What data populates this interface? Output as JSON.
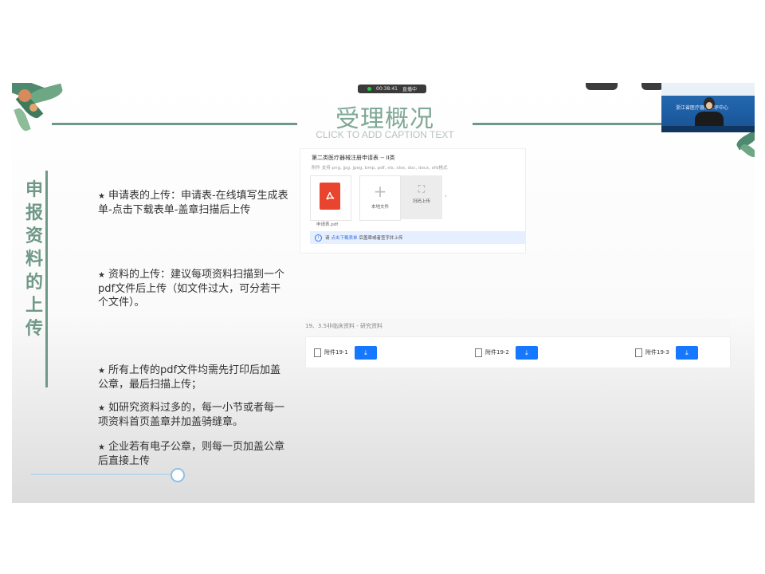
{
  "recording": {
    "time": "00:38:41",
    "status": "直播中"
  },
  "slide": {
    "title": "受理概况",
    "subtitle": "CLICK TO ADD CAPTION TEXT",
    "side_heading": "申报资料的上传",
    "bullets": [
      "申请表的上传：申请表-在线填写生成表单-点击下载表单-盖章扫描后上传",
      "资料的上传：建议每项资料扫描到一个pdf文件后上传（如文件过大，可分若干个文件）。",
      "所有上传的pdf文件均需先打印后加盖公章，最后扫描上传；",
      "如研究资料过多的，每一小节或者每一项资料首页盖章并加盖骑缝章。",
      "企业若有电子公章，则每一页加盖公章后直接上传"
    ],
    "bullet_star": "★"
  },
  "upload_form": {
    "title": "第二类医疗器械注册申请表 -- II类",
    "hint": "附件  支持 png, jpg, jpeg, bmp, pdf, xls, xlsx, doc, docx, ofd格式",
    "pdf_file_name": "申请表.pdf",
    "local_file_label": "本地文件",
    "scan_upload_label": "扫码上传",
    "notice_prefix": "请",
    "notice_link": "点击下载表单",
    "notice_suffix": "后盖章或者签字并上传"
  },
  "research": {
    "header": "19、3.5非临床资料 - 研究资料",
    "attachments": [
      {
        "name": "附件19-1"
      },
      {
        "name": "附件19-2"
      },
      {
        "name": "附件19-3"
      }
    ],
    "download_glyph": "⤓"
  },
  "presenter": {
    "org_text": "浙江省医疗器械审评中心"
  },
  "colors": {
    "accent_green": "#6f9987",
    "primary_blue": "#1677ff",
    "pdf_red": "#e8442e"
  },
  "icons": [
    "pdf-icon",
    "plus-icon",
    "scan-icon",
    "info-icon",
    "document-icon",
    "download-icon"
  ]
}
